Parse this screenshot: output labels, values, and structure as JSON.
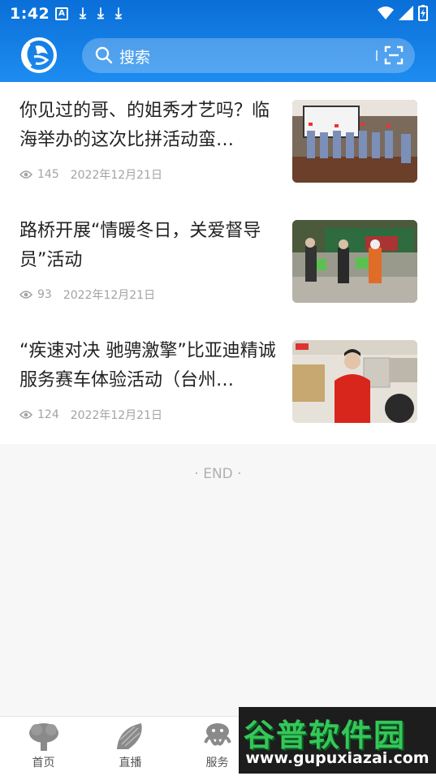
{
  "status_bar": {
    "time": "1:42",
    "notif_a": "A"
  },
  "search": {
    "placeholder": "搜索"
  },
  "articles": [
    {
      "title": "你见过的哥、的姐秀才艺吗？临海举办的这次比拼活动蛮…",
      "views": "145",
      "date": "2022年12月21日"
    },
    {
      "title": "路桥开展“情暖冬日，关爱督导员”活动",
      "views": "93",
      "date": "2022年12月21日"
    },
    {
      "title": "“疾速对决 驰骋激擎”比亚迪精诚服务赛车体验活动（台州…",
      "views": "124",
      "date": "2022年12月21日"
    }
  ],
  "end_text": "· END ·",
  "tabs": [
    {
      "label": "首页"
    },
    {
      "label": "直播"
    },
    {
      "label": "服务"
    }
  ],
  "watermark": {
    "big": "谷普软件园",
    "small": "www.gupuxiazai.com"
  },
  "colors": {
    "header": "#1d8cf0",
    "watermark_green": "#35c759"
  }
}
